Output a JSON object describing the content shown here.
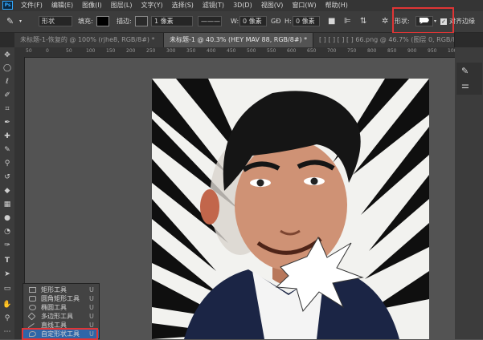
{
  "app": {
    "logo": "Ps"
  },
  "menu": [
    "文件(F)",
    "编辑(E)",
    "图像(I)",
    "图层(L)",
    "文字(Y)",
    "选择(S)",
    "滤镜(T)",
    "3D(D)",
    "视图(V)",
    "窗口(W)",
    "帮助(H)"
  ],
  "options": {
    "mode": "形状",
    "fill_label": "填充:",
    "stroke_label": "描边:",
    "stroke_width": "1 像素",
    "w_label": "W:",
    "w_value": "0 像素",
    "link": "GĐ",
    "h_label": "H:",
    "h_value": "0 像素",
    "shape_label": "形状:",
    "align_label": "对齐边缘",
    "fill_color": "#000000",
    "highlight_color": "#e03535"
  },
  "tabs": [
    {
      "label": "未标题-1-恢复的 @ 100% (rjhe8, RGB/8#) *"
    },
    {
      "label": "未标题-1 @ 40.3% (HEY   MAV 88, RGB/8#) *"
    },
    {
      "label": "[ ]  [ ]  [ ]  [ ]  66.png @ 46.7% (图层 0, RGB/8 *)"
    }
  ],
  "ruler": [
    "50",
    "0",
    "50",
    "100",
    "150",
    "200",
    "250",
    "300",
    "350",
    "400",
    "450",
    "500",
    "550",
    "600",
    "650",
    "700",
    "750",
    "800",
    "850",
    "900",
    "950",
    "1000"
  ],
  "tools": [
    "move-tool",
    "marquee-tool",
    "lasso-tool",
    "quick-select-tool",
    "crop-tool",
    "eyedropper-tool",
    "healing-tool",
    "brush-tool",
    "stamp-tool",
    "history-brush-tool",
    "eraser-tool",
    "gradient-tool",
    "blur-tool",
    "dodge-tool",
    "pen-tool",
    "type-tool",
    "path-select-tool",
    "shape-tool",
    "hand-tool",
    "zoom-tool"
  ],
  "flyout": [
    {
      "label": "矩形工具",
      "key": "U"
    },
    {
      "label": "圆角矩形工具",
      "key": "U"
    },
    {
      "label": "椭圆工具",
      "key": "U"
    },
    {
      "label": "多边形工具",
      "key": "U"
    },
    {
      "label": "直线工具",
      "key": "U"
    },
    {
      "label": "自定形状工具",
      "key": "U"
    }
  ]
}
